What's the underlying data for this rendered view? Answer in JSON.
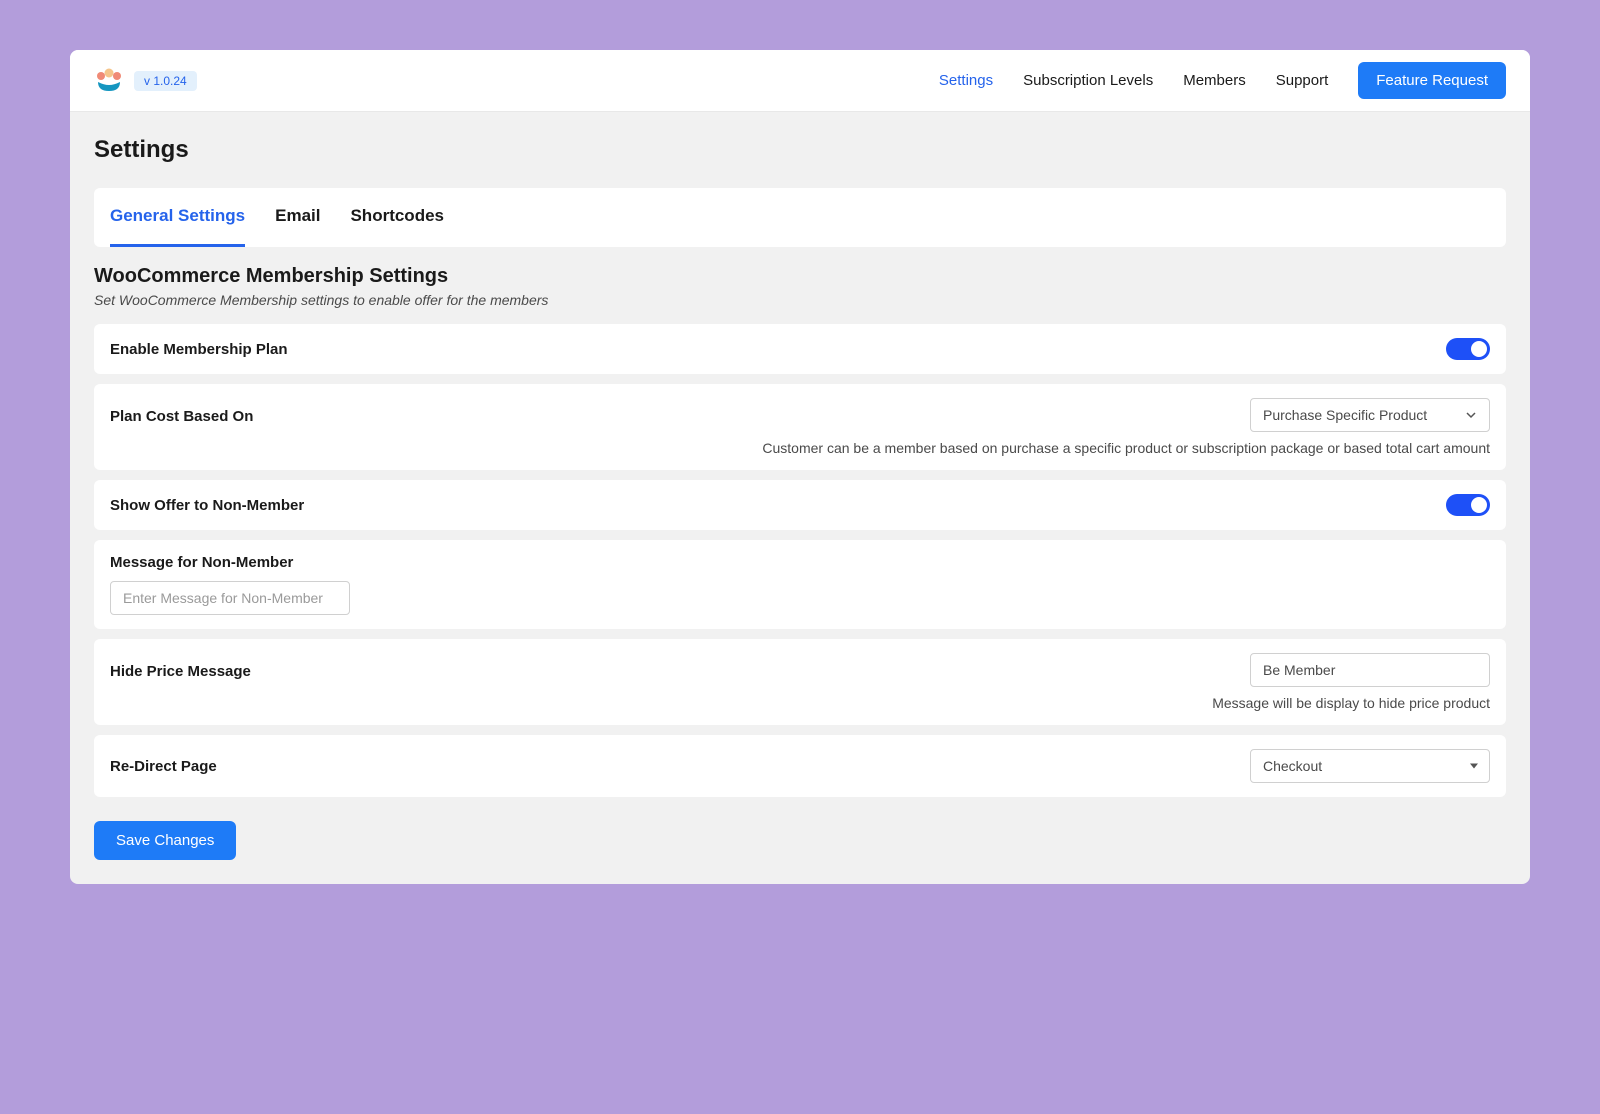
{
  "header": {
    "version": "v 1.0.24",
    "nav": {
      "settings": "Settings",
      "subscription_levels": "Subscription Levels",
      "members": "Members",
      "support": "Support",
      "feature_request": "Feature Request"
    }
  },
  "page": {
    "title": "Settings"
  },
  "tabs": {
    "general": "General Settings",
    "email": "Email",
    "shortcodes": "Shortcodes"
  },
  "section": {
    "title": "WooCommerce Membership Settings",
    "subtitle": "Set WooCommerce Membership settings to enable offer for the members"
  },
  "settings": {
    "enable_plan": {
      "label": "Enable Membership Plan",
      "value": true
    },
    "plan_cost": {
      "label": "Plan Cost Based On",
      "selected": "Purchase Specific Product",
      "help": "Customer can be a member based on purchase a specific product or subscription package or based total cart amount"
    },
    "show_offer": {
      "label": "Show Offer to Non-Member",
      "value": true
    },
    "message_non_member": {
      "label": "Message for Non-Member",
      "placeholder": "Enter Message for Non-Member",
      "value": ""
    },
    "hide_price": {
      "label": "Hide Price Message",
      "value": "Be Member",
      "help": "Message will be display to hide price product"
    },
    "redirect": {
      "label": "Re-Direct Page",
      "selected": "Checkout"
    }
  },
  "actions": {
    "save": "Save Changes"
  }
}
